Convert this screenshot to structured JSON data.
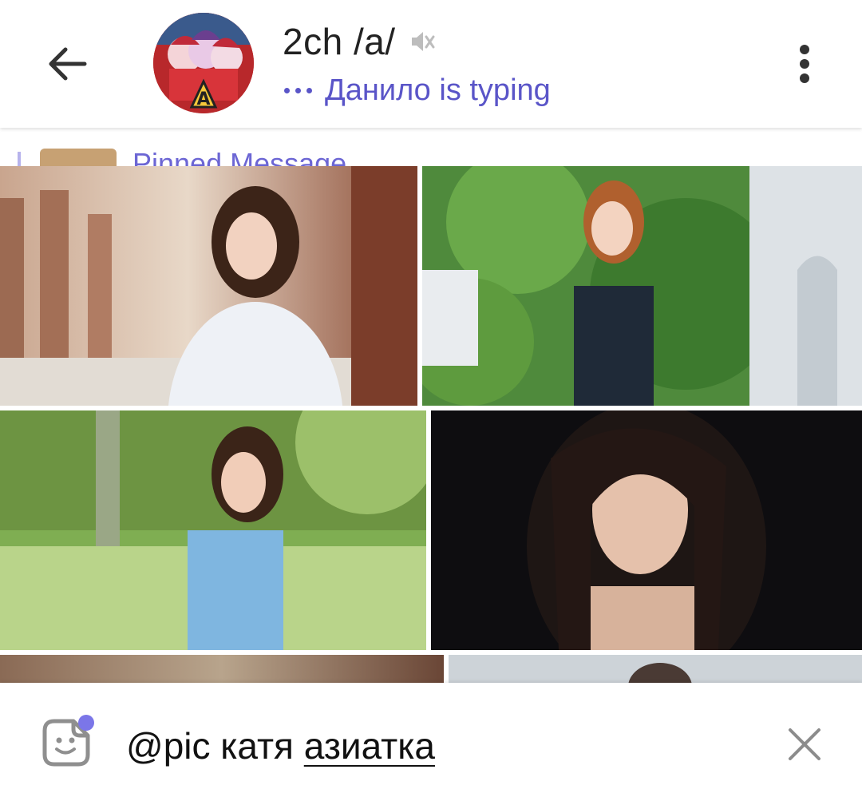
{
  "header": {
    "title": "2ch /a/",
    "status_text": "Данило is typing",
    "back_icon": "arrow-left-icon",
    "mute_icon": "muted-speaker-icon",
    "menu_icon": "more-vertical-icon",
    "accent_color": "#5a55c8"
  },
  "pinned": {
    "label": "Pinned Message"
  },
  "photos": [
    {
      "alt": "photo-woman-colonnade"
    },
    {
      "alt": "photo-woman-greenery"
    },
    {
      "alt": "photo-woman-park"
    },
    {
      "alt": "photo-woman-dark-background"
    }
  ],
  "input": {
    "text_prefix": "@pic катя ",
    "text_underlined": "азиатка",
    "sticker_icon": "sticker-icon",
    "clear_icon": "close-icon"
  }
}
